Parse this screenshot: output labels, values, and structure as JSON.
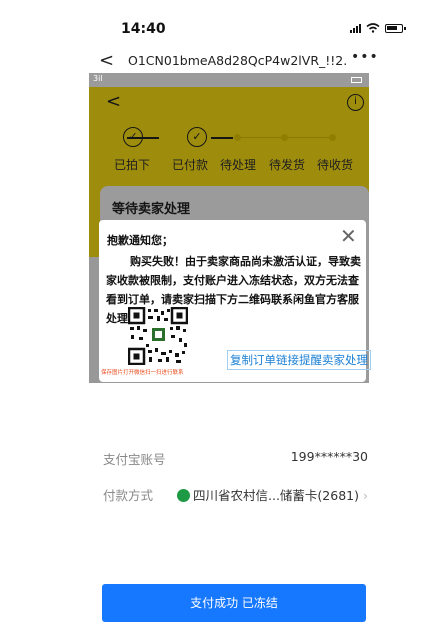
{
  "status_bar": {
    "time": "14:40"
  },
  "nav": {
    "back": "<",
    "title": "O1CN01bmeA8d28QcP4w2lVR_!!2...",
    "more": "•••"
  },
  "screenshot": {
    "inner_status": {
      "signal": "3il"
    },
    "back": "<",
    "info": "i",
    "steps": [
      {
        "label": "已拍下",
        "state": "done"
      },
      {
        "label": "已付款",
        "state": "done"
      },
      {
        "label": "待处理",
        "state": "pending"
      },
      {
        "label": "待发货",
        "state": "pending"
      },
      {
        "label": "待收货",
        "state": "pending"
      }
    ],
    "card_title": "等待卖家处理",
    "dialog": {
      "title": "抱歉通知您；",
      "close": "✕",
      "body": "购买失败！由于卖家商品尚未激活认证，导致卖家收款被限制，支付账户进入冻结状态，双方无法查看到订单，请卖家扫描下方二维码联系闲鱼官方客服处理！",
      "qr_caption": "保存图片打开微信扫一扫进行联系",
      "copy_button": "复制订单链接提醒卖家处理"
    }
  },
  "details": {
    "account_label": "支付宝账号",
    "account_value": "199******30",
    "method_label": "付款方式",
    "method_value": "四川省农村信...储蓄卡(2681)"
  },
  "pay_button": "支付成功 已冻结",
  "colors": {
    "accent": "#1677ff",
    "yellow": "#ffe316",
    "link": "#1a7fd4",
    "caption": "#e94a1a"
  }
}
